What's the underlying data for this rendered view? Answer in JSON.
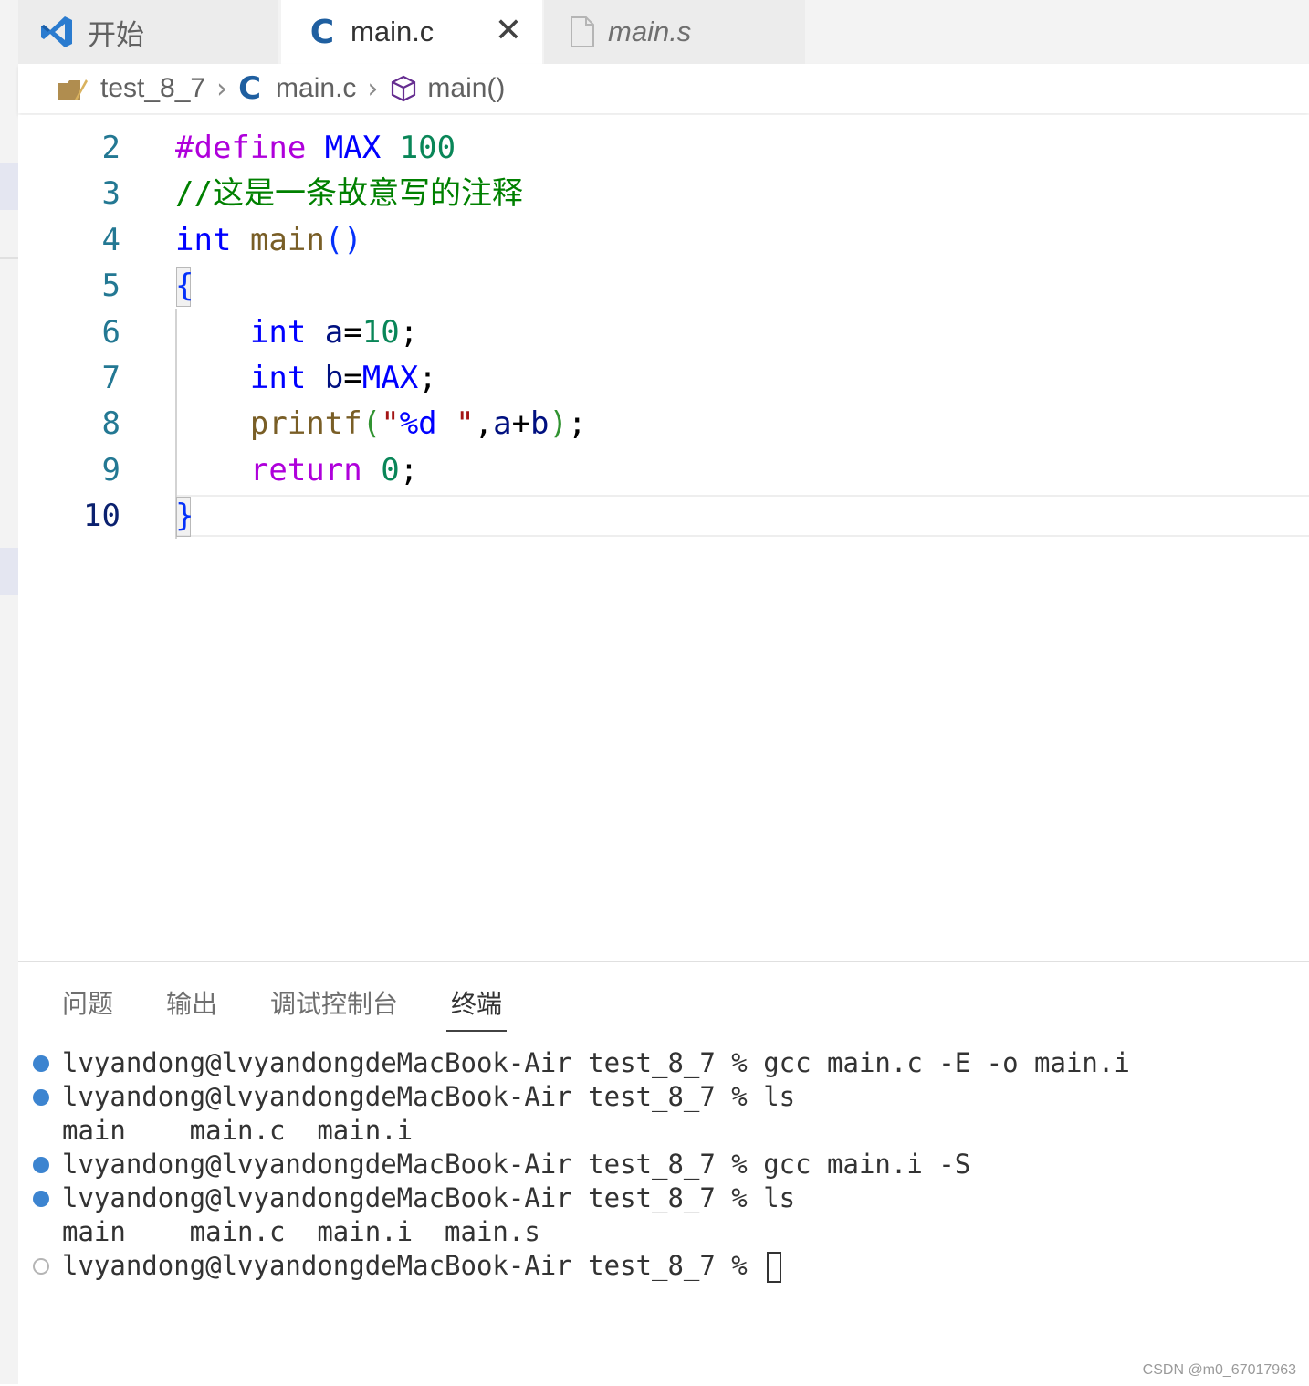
{
  "tabs": [
    {
      "label": "开始",
      "icon": "vscode-logo-icon"
    },
    {
      "label": "main.c",
      "icon": "c-file-icon",
      "active": true,
      "close": "✕"
    },
    {
      "label": "main.s",
      "icon": "file-icon",
      "preview": true
    }
  ],
  "breadcrumb": {
    "folder": "test_8_7",
    "file_icon": "C",
    "file": "main.c",
    "symbol": "main()",
    "separator": "›"
  },
  "editor": {
    "lines": [
      {
        "num": "2",
        "tokens": [
          {
            "t": "#define",
            "c": "pp"
          },
          {
            "t": " ",
            "c": "pl"
          },
          {
            "t": "MAX",
            "c": "macro"
          },
          {
            "t": " ",
            "c": "pl"
          },
          {
            "t": "100",
            "c": "num"
          }
        ]
      },
      {
        "num": "3",
        "tokens": [
          {
            "t": "//这是一条故意写的注释",
            "c": "cmt"
          }
        ]
      },
      {
        "num": "4",
        "tokens": [
          {
            "t": "int",
            "c": "kw"
          },
          {
            "t": " ",
            "c": "pl"
          },
          {
            "t": "main",
            "c": "fn"
          },
          {
            "t": "()",
            "c": "p1"
          }
        ]
      },
      {
        "num": "5",
        "tokens": [
          {
            "t": "{",
            "c": "p1"
          }
        ]
      },
      {
        "num": "6",
        "tokens": [
          {
            "t": "    ",
            "c": "pl"
          },
          {
            "t": "int",
            "c": "kw"
          },
          {
            "t": " ",
            "c": "pl"
          },
          {
            "t": "a",
            "c": "var"
          },
          {
            "t": "=",
            "c": "pl"
          },
          {
            "t": "10",
            "c": "num"
          },
          {
            "t": ";",
            "c": "pl"
          }
        ]
      },
      {
        "num": "7",
        "tokens": [
          {
            "t": "    ",
            "c": "pl"
          },
          {
            "t": "int",
            "c": "kw"
          },
          {
            "t": " ",
            "c": "pl"
          },
          {
            "t": "b",
            "c": "var"
          },
          {
            "t": "=",
            "c": "pl"
          },
          {
            "t": "MAX",
            "c": "macro"
          },
          {
            "t": ";",
            "c": "pl"
          }
        ]
      },
      {
        "num": "8",
        "tokens": [
          {
            "t": "    ",
            "c": "pl"
          },
          {
            "t": "printf",
            "c": "fn"
          },
          {
            "t": "(",
            "c": "p2"
          },
          {
            "t": "\"",
            "c": "str"
          },
          {
            "t": "%d",
            "c": "esc"
          },
          {
            "t": " \"",
            "c": "str"
          },
          {
            "t": ",",
            "c": "pl"
          },
          {
            "t": "a",
            "c": "var"
          },
          {
            "t": "+",
            "c": "pl"
          },
          {
            "t": "b",
            "c": "var"
          },
          {
            "t": ")",
            "c": "p2"
          },
          {
            "t": ";",
            "c": "pl"
          }
        ]
      },
      {
        "num": "9",
        "tokens": [
          {
            "t": "    ",
            "c": "pl"
          },
          {
            "t": "return",
            "c": "ctl"
          },
          {
            "t": " ",
            "c": "pl"
          },
          {
            "t": "0",
            "c": "num"
          },
          {
            "t": ";",
            "c": "pl"
          }
        ]
      },
      {
        "num": "10",
        "active": true,
        "tokens": [
          {
            "t": "}",
            "c": "p1"
          }
        ]
      }
    ]
  },
  "panel": {
    "tabs": [
      "问题",
      "输出",
      "调试控制台",
      "终端"
    ],
    "active_tab": "终端",
    "terminal": [
      {
        "marker": "success",
        "text": "lvyandong@lvyandongdeMacBook-Air test_8_7 % gcc main.c -E -o main.i"
      },
      {
        "marker": "success",
        "text": "lvyandong@lvyandongdeMacBook-Air test_8_7 % ls"
      },
      {
        "marker": "none",
        "text": "main    main.c  main.i"
      },
      {
        "marker": "success",
        "text": "lvyandong@lvyandongdeMacBook-Air test_8_7 % gcc main.i -S"
      },
      {
        "marker": "success",
        "text": "lvyandong@lvyandongdeMacBook-Air test_8_7 % ls"
      },
      {
        "marker": "none",
        "text": "main    main.c  main.i  main.s"
      },
      {
        "marker": "pending",
        "text": "lvyandong@lvyandongdeMacBook-Air test_8_7 % ",
        "cursor": true
      }
    ]
  },
  "watermark": "CSDN @m0_67017963",
  "colors": {
    "accent": "#1f5fa0",
    "terminal_dot": "#3c84d0",
    "keyword": "#0000ff",
    "comment": "#008000"
  }
}
